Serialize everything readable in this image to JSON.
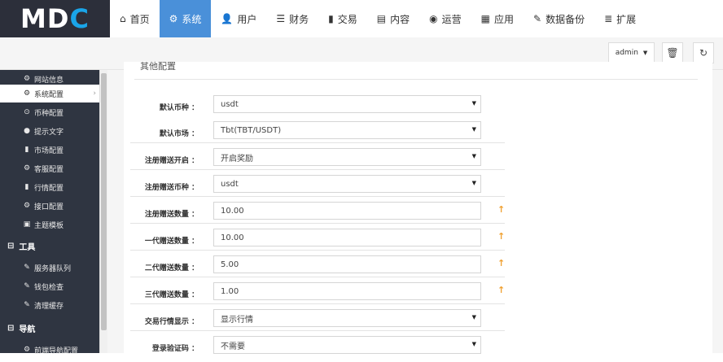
{
  "logo": {
    "text_m": "M",
    "text_d": "D",
    "text_c": "C"
  },
  "nav": [
    {
      "icon": "⌂",
      "label": "首页"
    },
    {
      "icon": "⚙",
      "label": "系统"
    },
    {
      "icon": "👤",
      "label": "用户"
    },
    {
      "icon": "☰",
      "label": "财务"
    },
    {
      "icon": "▮",
      "label": "交易"
    },
    {
      "icon": "▤",
      "label": "内容"
    },
    {
      "icon": "◉",
      "label": "运营"
    },
    {
      "icon": "▦",
      "label": "应用"
    },
    {
      "icon": "✎",
      "label": "数据备份"
    },
    {
      "icon": "≣",
      "label": "扩展"
    }
  ],
  "user": {
    "name": "admin",
    "caret": "▼"
  },
  "actions": {
    "trash": "🗑",
    "refresh": "↻"
  },
  "sidebar": {
    "items": [
      {
        "icon": "⚙",
        "label": "网站信息"
      },
      {
        "icon": "⚙",
        "label": "系统配置"
      },
      {
        "icon": "⊙",
        "label": "币种配置"
      },
      {
        "icon": "●",
        "label": "提示文字"
      },
      {
        "icon": "▮",
        "label": "市场配置"
      },
      {
        "icon": "⚙",
        "label": "客服配置"
      },
      {
        "icon": "▮",
        "label": "行情配置"
      },
      {
        "icon": "⚙",
        "label": "接口配置"
      },
      {
        "icon": "▣",
        "label": "主题模板"
      }
    ],
    "groups": [
      {
        "icon": "⊟",
        "label": "工具"
      },
      {
        "icon": "⊟",
        "label": "导航"
      }
    ],
    "tools": [
      {
        "icon": "✎",
        "label": "服务器队列"
      },
      {
        "icon": "✎",
        "label": "钱包检查"
      },
      {
        "icon": "✎",
        "label": "清理缓存"
      }
    ],
    "nav_items": [
      {
        "icon": "⚙",
        "label": "前端导航配置"
      }
    ],
    "chevron": "›"
  },
  "panel": {
    "title": "其他配置"
  },
  "form": [
    {
      "label": "默认币种 ：",
      "value": "usdt",
      "type": "select"
    },
    {
      "label": "默认市场 ：",
      "value": "Tbt(TBT/USDT)",
      "type": "select"
    },
    {
      "label": "注册赠送开启 ：",
      "value": "开启奖励",
      "type": "select"
    },
    {
      "label": "注册赠送币种 ：",
      "value": "usdt",
      "type": "select"
    },
    {
      "label": "注册赠送数量 ：",
      "value": "10.00",
      "type": "input"
    },
    {
      "label": "一代赠送数量 ：",
      "value": "10.00",
      "type": "input"
    },
    {
      "label": "二代赠送数量 ：",
      "value": "5.00",
      "type": "input"
    },
    {
      "label": "三代赠送数量 ：",
      "value": "1.00",
      "type": "input"
    },
    {
      "label": "交易行情显示 ：",
      "value": "显示行情",
      "type": "select"
    },
    {
      "label": "登录验证码 ：",
      "value": "不需要",
      "type": "select"
    }
  ],
  "select_caret": "▼",
  "input_arrow": "↑",
  "colors": {
    "accent": "#4a90d9",
    "sidebar_bg": "#2f3541",
    "logo_bg": "#2c2f3a",
    "arrow": "#f0a030"
  }
}
